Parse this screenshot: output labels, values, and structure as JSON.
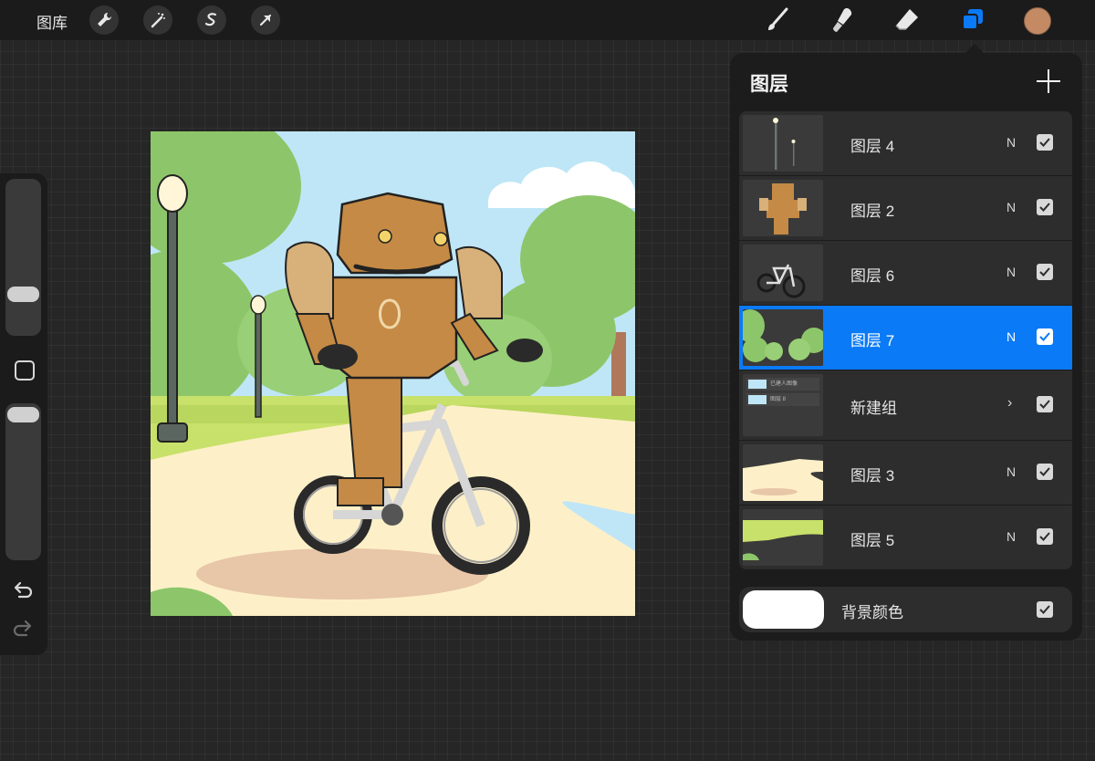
{
  "topbar": {
    "gallery_label": "图库",
    "left_tools": [
      "wrench-icon",
      "magic-wand-icon",
      "selection-icon",
      "transform-icon"
    ],
    "right_tools": [
      "brush-icon",
      "smudge-icon",
      "eraser-icon",
      "layers-icon"
    ],
    "current_color": "#c48a64",
    "accent": "#0a7af6"
  },
  "sidebar": {
    "brush_size_slider": "size-slider",
    "opacity_slider": "opacity-slider",
    "undo_icon": "undo-icon",
    "redo_icon": "redo-icon"
  },
  "canvas": {
    "description_color_sky": "#bfe6f6"
  },
  "layers_panel": {
    "title": "图层",
    "layers": [
      {
        "name": "图层 4",
        "blend": "N",
        "visible": true,
        "selected": false
      },
      {
        "name": "图层 2",
        "blend": "N",
        "visible": true,
        "selected": false
      },
      {
        "name": "图层 6",
        "blend": "N",
        "visible": true,
        "selected": false
      },
      {
        "name": "图层 7",
        "blend": "N",
        "visible": true,
        "selected": true
      },
      {
        "name": "新建组",
        "blend": "›",
        "visible": true,
        "selected": false,
        "is_group": true
      },
      {
        "name": "图层 3",
        "blend": "N",
        "visible": true,
        "selected": false
      },
      {
        "name": "图层 5",
        "blend": "N",
        "visible": true,
        "selected": false
      }
    ],
    "group_thumb_rows": [
      "已建人图像",
      "图层 8"
    ],
    "background": {
      "name": "背景颜色",
      "visible": true,
      "color": "#ffffff"
    }
  }
}
